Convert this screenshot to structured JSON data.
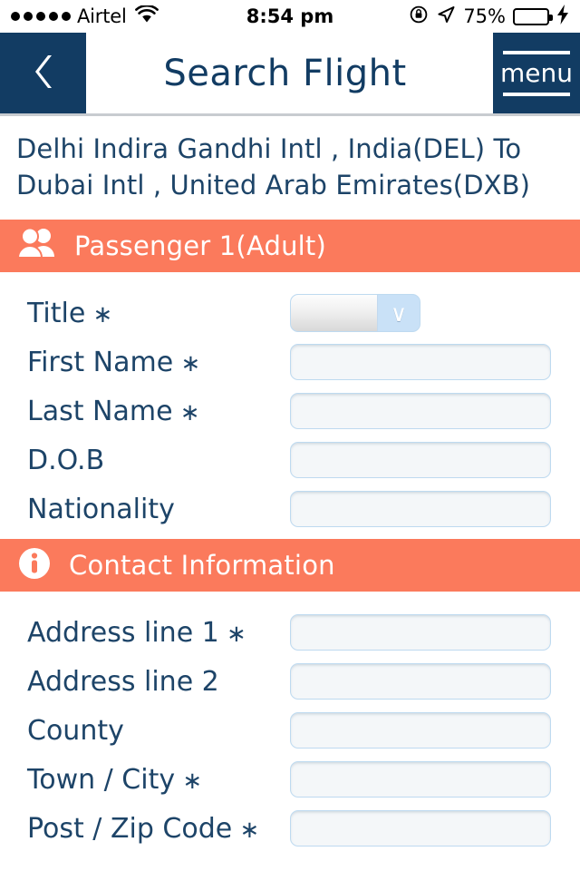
{
  "status_bar": {
    "carrier": "Airtel",
    "signal_dots": 5,
    "wifi_icon": "wifi-icon",
    "time": "8:54 pm",
    "rotation_lock_icon": "rotation-lock-icon",
    "location_icon": "location-arrow-icon",
    "battery_percent": "75%",
    "battery_level": 75,
    "charging_icon": "lightning-bolt-icon",
    "battery_color": "#42d661"
  },
  "navbar": {
    "back_icon": "chevron-left-icon",
    "title": "Search Flight",
    "menu_label": "menu",
    "bar_color": "#123c63",
    "title_color": "#123c63"
  },
  "route": {
    "text": "Delhi Indira Gandhi Intl , India(DEL) To Dubai Intl , United Arab Emirates(DXB)"
  },
  "sections": [
    {
      "id": "passenger",
      "icon": "passengers-icon",
      "title": "Passenger 1(Adult)",
      "header_color": "#fb7a5c",
      "fields": [
        {
          "label": "Title",
          "required": true,
          "type": "select",
          "value": "",
          "chevron": "∨"
        },
        {
          "label": "First Name",
          "required": true,
          "type": "text",
          "value": "",
          "placeholder": ""
        },
        {
          "label": "Last Name",
          "required": true,
          "type": "text",
          "value": "",
          "placeholder": ""
        },
        {
          "label": "D.O.B",
          "required": false,
          "type": "text",
          "value": "",
          "placeholder": ""
        },
        {
          "label": "Nationality",
          "required": false,
          "type": "text",
          "value": "",
          "placeholder": ""
        }
      ]
    },
    {
      "id": "contact",
      "icon": "info-icon",
      "title": "Contact Information",
      "header_color": "#fb7a5c",
      "fields": [
        {
          "label": "Address line 1",
          "required": true,
          "type": "text",
          "value": "",
          "placeholder": ""
        },
        {
          "label": "Address line 2",
          "required": false,
          "type": "text",
          "value": "",
          "placeholder": ""
        },
        {
          "label": "County",
          "required": false,
          "type": "text",
          "value": "",
          "placeholder": ""
        },
        {
          "label": "Town / City",
          "required": true,
          "type": "text",
          "value": "",
          "placeholder": ""
        },
        {
          "label": "Post / Zip Code",
          "required": true,
          "type": "text",
          "value": "",
          "placeholder": ""
        }
      ]
    }
  ],
  "required_marker": "∗"
}
